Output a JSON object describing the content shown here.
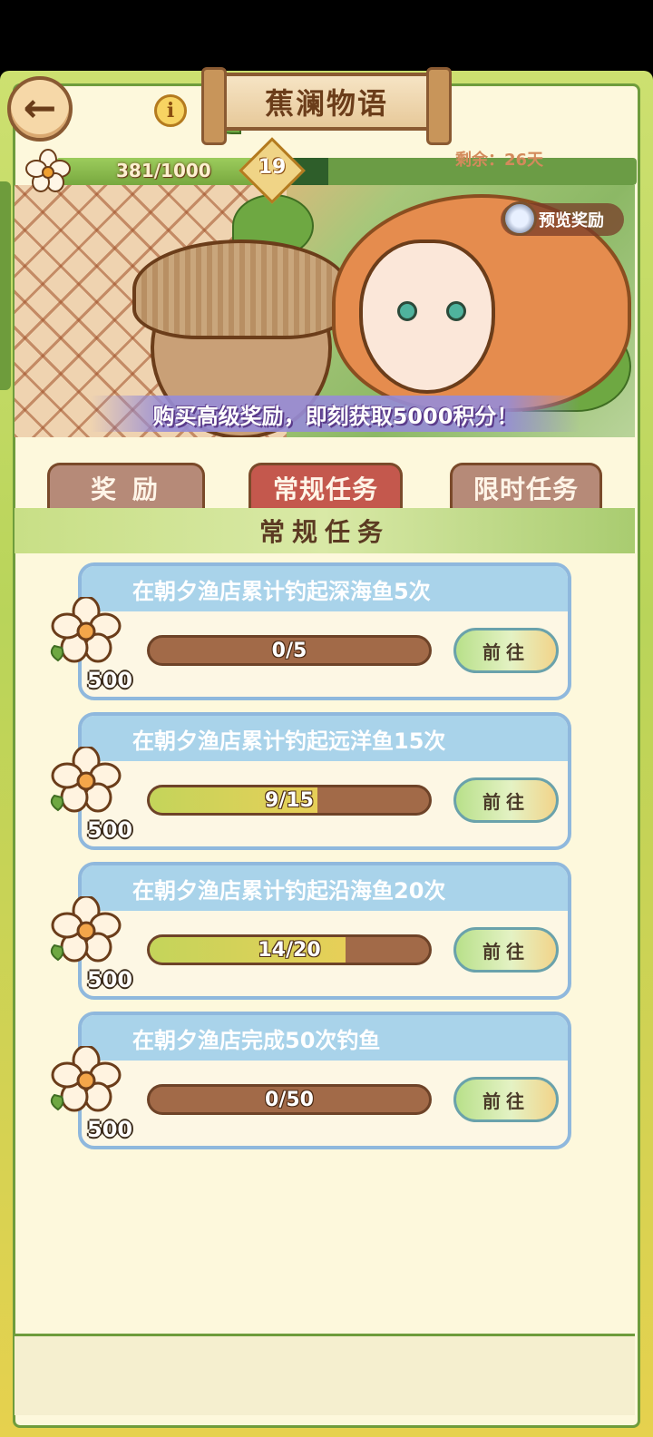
{
  "header": {
    "title": "蕉澜物语",
    "progress_text": "381/1000",
    "progress_fraction": 0.381,
    "level": "19",
    "remaining": "剩余：26天"
  },
  "banner": {
    "preview_label": "预览奖励",
    "promo_text": "购买高级奖励，即刻获取5000积分！"
  },
  "tabs": [
    {
      "label": "奖 励",
      "active": false
    },
    {
      "label": "常规任务",
      "active": true
    },
    {
      "label": "限时任务",
      "active": false
    }
  ],
  "section_title": "常规任务",
  "tasks": [
    {
      "title": "在朝夕渔店累计钓起深海鱼5次",
      "progress": "0/5",
      "fraction": 0.0,
      "reward": "500",
      "button": "前往"
    },
    {
      "title": "在朝夕渔店累计钓起远洋鱼15次",
      "progress": "9/15",
      "fraction": 0.6,
      "reward": "500",
      "button": "前往"
    },
    {
      "title": "在朝夕渔店累计钓起沿海鱼20次",
      "progress": "14/20",
      "fraction": 0.7,
      "reward": "500",
      "button": "前往"
    },
    {
      "title": "在朝夕渔店完成50次钓鱼",
      "progress": "0/50",
      "fraction": 0.0,
      "reward": "500",
      "button": "前往"
    }
  ],
  "colors": {
    "panel": "#fdf8dc",
    "frame_green": "#6e9c3c",
    "active_tab": "#c4584d",
    "inactive_tab": "#b68a78",
    "card_header": "#a9d3ea",
    "bar_track": "#a26a48"
  },
  "icons": [
    "back-arrow-icon",
    "info-icon",
    "flower-icon",
    "magnifier-icon"
  ]
}
